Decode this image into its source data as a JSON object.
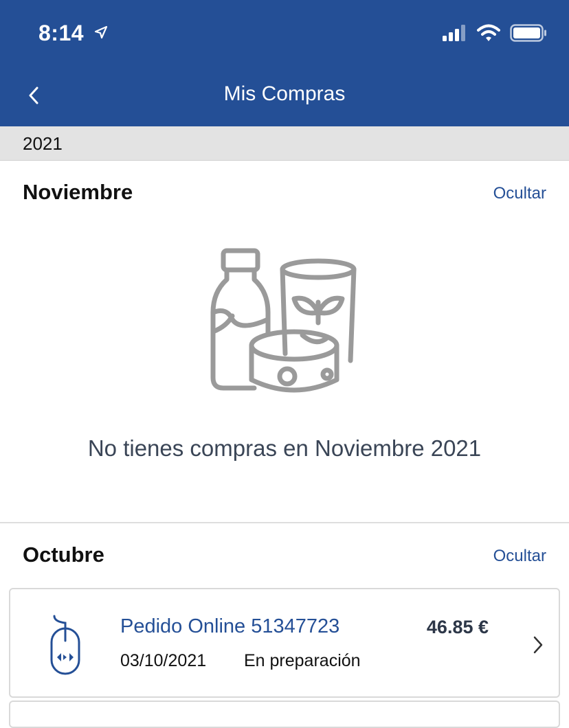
{
  "status_bar": {
    "time": "8:14"
  },
  "header": {
    "title": "Mis Compras",
    "back_icon": "chevron-left-icon"
  },
  "year": "2021",
  "months": [
    {
      "name": "Noviembre",
      "hide_label": "Ocultar",
      "empty_message": "No tienes compras en Noviembre 2021"
    },
    {
      "name": "Octubre",
      "hide_label": "Ocultar",
      "orders": [
        {
          "name": "Pedido Online 51347723",
          "price": "46.85 €",
          "date": "03/10/2021",
          "status": "En preparación"
        }
      ]
    }
  ],
  "colors": {
    "brand": "#244f96",
    "year_bar": "#e3e3e3",
    "illustration": "#9a9a9a"
  }
}
